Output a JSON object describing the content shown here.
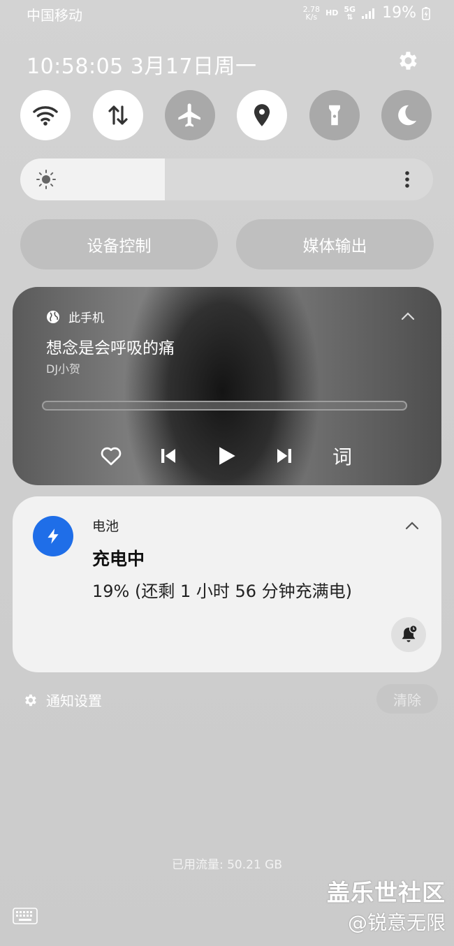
{
  "status_bar": {
    "carrier": "中国移动",
    "net_speed_value": "2.78",
    "net_speed_unit": "K/s",
    "hd": "HD",
    "network": "5G",
    "battery_percent": "19%"
  },
  "header": {
    "datetime": "10:58:05  3月17日周一"
  },
  "quick_toggles": [
    {
      "name": "wifi",
      "on": true
    },
    {
      "name": "mobile-data",
      "on": true
    },
    {
      "name": "airplane-mode",
      "on": false
    },
    {
      "name": "location",
      "on": true
    },
    {
      "name": "flashlight",
      "on": false
    },
    {
      "name": "dark-mode",
      "on": false
    }
  ],
  "brightness": {
    "level": 0.35
  },
  "buttons": {
    "device_control": "设备控制",
    "media_output": "媒体输出"
  },
  "media": {
    "source": "此手机",
    "title": "想念是会呼吸的痛",
    "artist": "DJ小贺",
    "progress": 0.0,
    "lyrics_label": "词"
  },
  "battery_notification": {
    "app": "电池",
    "title": "充电中",
    "body": "19% (还剩 1 小时 56 分钟充满电)",
    "icon_color": "#1f6ee8"
  },
  "footer": {
    "notification_settings": "通知设置",
    "clear": "清除",
    "data_usage": "已用流量: 50.21 GB"
  },
  "watermark": {
    "line1": "盖乐世社区",
    "line2": "@锐意无限"
  }
}
